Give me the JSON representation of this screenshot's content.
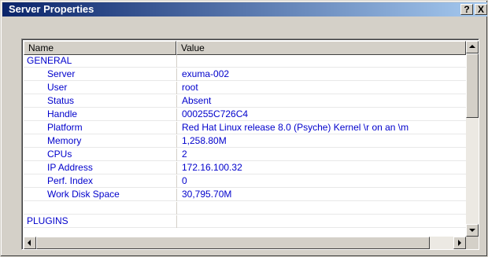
{
  "window": {
    "title": "Server Properties",
    "help_label": "?",
    "close_label": "X"
  },
  "table": {
    "columns": [
      "Name",
      "Value"
    ],
    "rows": [
      {
        "type": "category",
        "name": "GENERAL",
        "value": ""
      },
      {
        "type": "item",
        "name": "Server",
        "value": "exuma-002"
      },
      {
        "type": "item",
        "name": "User",
        "value": "root"
      },
      {
        "type": "item",
        "name": "Status",
        "value": "Absent"
      },
      {
        "type": "item",
        "name": "Handle",
        "value": "000255C726C4"
      },
      {
        "type": "item",
        "name": "Platform",
        "value": "Red Hat Linux release 8.0 (Psyche) Kernel \\r on an \\m"
      },
      {
        "type": "item",
        "name": "Memory",
        "value": "1,258.80M"
      },
      {
        "type": "item",
        "name": "CPUs",
        "value": "2"
      },
      {
        "type": "item",
        "name": "IP Address",
        "value": "172.16.100.32"
      },
      {
        "type": "item",
        "name": "Perf. Index",
        "value": "0"
      },
      {
        "type": "item",
        "name": "Work Disk Space",
        "value": "30,795.70M"
      },
      {
        "type": "blank",
        "name": "",
        "value": ""
      },
      {
        "type": "category",
        "name": "PLUGINS",
        "value": ""
      }
    ]
  },
  "icons": {
    "scroll_up": "arrow-up-icon",
    "scroll_down": "arrow-down-icon",
    "scroll_left": "arrow-left-icon",
    "scroll_right": "arrow-right-icon"
  },
  "colors": {
    "titlebar_start": "#0a246a",
    "titlebar_end": "#a6caf0",
    "text": "#0000cc",
    "face": "#d4d0c8"
  }
}
